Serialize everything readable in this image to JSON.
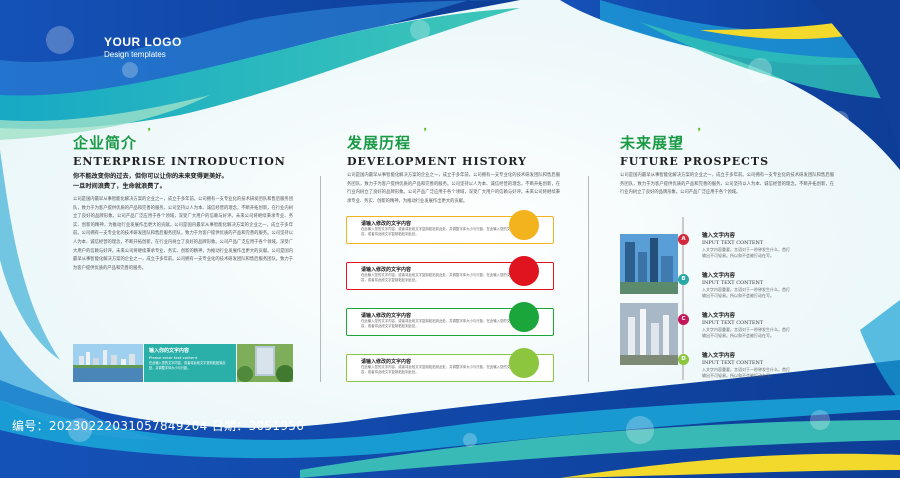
{
  "logo": {
    "name": "YOUR LOGO",
    "sub": "Design templates"
  },
  "sections": {
    "enterprise": {
      "cn": "企业简介",
      "en": "ENTERPRISE INTRODUCTION"
    },
    "history": {
      "cn": "发展历程",
      "en": "DEVELOPMENT HISTORY"
    },
    "future": {
      "cn": "未来展望",
      "en": "FUTURE PROSPECTS"
    }
  },
  "enterprise": {
    "quote_1": "你不能改变你的过去，但你可以让你的未来变得更美好。",
    "quote_2": "一旦时间浪费了，生命就浪费了。",
    "body": "公司是国内最早从事智能化解决方案的企业之一，成立于多年前。公司拥有一支专业化的技术研发团队和售后服务团队，致力于为客户提供优质的产品和完善的服务。公司坚持以人为本、诚信经营的理念，不断开拓创新，在行业内树立了良好的品牌形象。公司产品广泛应用于各个领域，深受广大用户的信赖与好评。未来公司将继续秉承专业、务实、创新的精神，为推动行业发展作出更大的贡献。公司是国内最早从事智能化解决方案的企业之一，成立于多年前。公司拥有一支专业化的技术研发团队和售后服务团队，致力于为客户提供优质的产品和完善的服务。公司坚持以人为本、诚信经营的理念，不断开拓创新，在行业内树立了良好的品牌形象。公司产品广泛应用于各个领域，深受广大用户的信赖与好评。未来公司将继续秉承专业、务实、创新的精神，为推动行业发展作出更大的贡献。公司是国内最早从事智能化解决方案的企业之一，成立于多年前。公司拥有一支专业化的技术研发团队和售后服务团队，致力于为客户提供优质的产品和完善的服务。",
    "teal_title": "输入你的文字内容",
    "teal_sub": "Please enter text content",
    "teal_body": "在此输入您的文字内容，或者将此段文字复制粘贴到此处，并调整字体大小与行距。"
  },
  "history": {
    "intro": "公司是国内最早从事智能化解决方案的企业之一，成立于多年前。公司拥有一支专业化的技术研发团队和售后服务团队，致力于为客户提供优质的产品和完善的服务。公司坚持以人为本、诚信经营的理念，不断开拓创新，在行业内树立了良好的品牌形象。公司产品广泛应用于各个领域，深受广大用户的信赖与好评。未来公司将继续秉承专业、务实、创新的精神，为推动行业发展作出更大的贡献。",
    "items": [
      {
        "title": "请输入修改的文字内容",
        "body": "在此输入您的文字内容，或者将此段文字复制粘贴到此处，并调整字体大小与行距。在此输入您的文字内容，或者将此段文字复制粘贴到此处。",
        "color": "#f2b31c"
      },
      {
        "title": "请输入修改的文字内容",
        "body": "在此输入您的文字内容，或者将此段文字复制粘贴到此处，并调整字体大小与行距。在此输入您的文字内容，或者将此段文字复制粘贴到此处。",
        "color": "#e0141e"
      },
      {
        "title": "请输入修改的文字内容",
        "body": "在此输入您的文字内容，或者将此段文字复制粘贴到此处，并调整字体大小与行距。在此输入您的文字内容，或者将此段文字复制粘贴到此处。",
        "color": "#1aa63a"
      },
      {
        "title": "请输入修改的文字内容",
        "body": "在此输入您的文字内容，或者将此段文字复制粘贴到此处，并调整字体大小与行距。在此输入您的文字内容，或者将此段文字复制粘贴到此处。",
        "color": "#8cc63e"
      }
    ]
  },
  "future": {
    "intro": "公司是国内最早从事智能化解决方案的企业之一，成立于多年前。公司拥有一支专业化的技术研发团队和售后服务团队，致力于为客户提供优质的产品和完善的服务。公司坚持以人为本、诚信经营的理念，不断开拓创新，在行业内树立了良好的品牌形象。公司产品广泛应用于各个领域。",
    "items": [
      {
        "letter": "A",
        "cn": "输入文字内容",
        "en": "INPUT TEXT CONTENT",
        "body": "入文字内容重要。言语对于一秒钟发生什么，首打输出不可轻易。所以和不会被打动在写。",
        "color": "#d6283c"
      },
      {
        "letter": "B",
        "cn": "输入文字内容",
        "en": "INPUT TEXT CONTENT",
        "body": "入文字内容重要。言语对于一秒钟发生什么，首打输出不可轻易。所以和不会被打动在写。",
        "color": "#2aa9a4"
      },
      {
        "letter": "C",
        "cn": "输入文字内容",
        "en": "INPUT TEXT CONTENT",
        "body": "入文字内容重要。言语对于一秒钟发生什么，首打输出不可轻易。所以和不会被打动在写。",
        "color": "#c2185b"
      },
      {
        "letter": "D",
        "cn": "输入文字内容",
        "en": "INPUT TEXT CONTENT",
        "body": "入文字内容重要。言语对于一秒钟发生什么，首打输出不可轻易。所以和不会被打动在写。",
        "color": "#8cc63e"
      }
    ]
  },
  "watermark": {
    "text": "编号：20230222031057849204 日期：3051956"
  }
}
